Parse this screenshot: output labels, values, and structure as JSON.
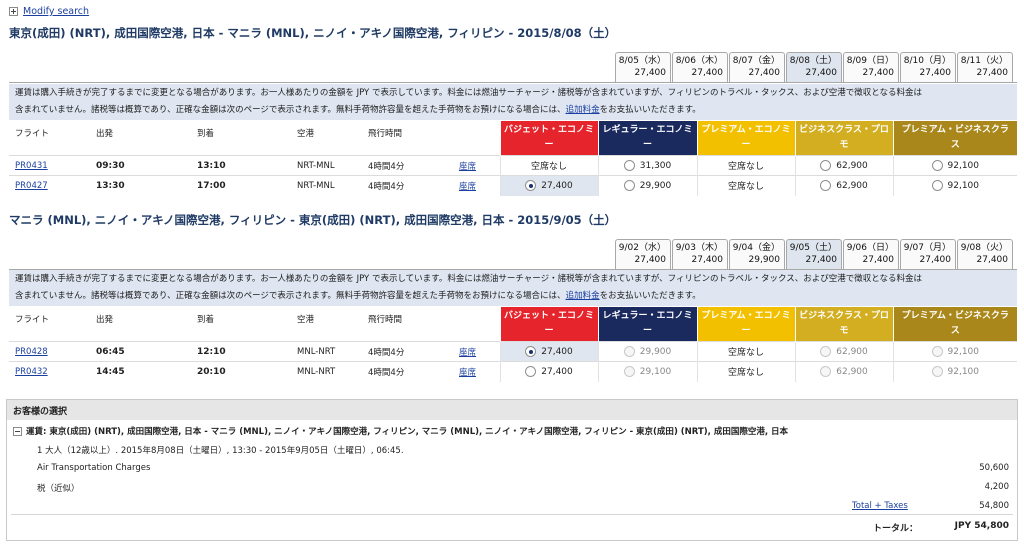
{
  "header": {
    "modify_search": "Modify search"
  },
  "outbound": {
    "title": "東京(成田) (NRT), 成田国際空港, 日本 - マニラ (MNL), ニノイ・アキノ国際空港, フィリピン - 2015/8/08（土）",
    "dates": [
      {
        "date": "8/05（水）",
        "price": "27,400"
      },
      {
        "date": "8/06（木）",
        "price": "27,400"
      },
      {
        "date": "8/07（金）",
        "price": "27,400"
      },
      {
        "date": "8/08（土）",
        "price": "27,400",
        "selected": true
      },
      {
        "date": "8/09（日）",
        "price": "27,400"
      },
      {
        "date": "8/10（月）",
        "price": "27,400"
      },
      {
        "date": "8/11（火）",
        "price": "27,400"
      }
    ],
    "notice_line1": "運賃は購入手続きが完了するまでに変更となる場合があります。お一人様あたりの金額を JPY で表示しています。料金には燃油サーチャージ・諸税等が含まれていますが、フィリピンのトラベル・タックス、および空港で徴収となる料金は",
    "notice_line2": "含まれていません。諸税等は概算であり、正確な金額は次のページで表示されます。無料手荷物許容量を超えた手荷物をお預けになる場合には、",
    "notice_link": "追加料金",
    "notice_tail": "をお支払いいただきます。",
    "flights": [
      {
        "flight": "PR0431",
        "depart": "09:30",
        "arrive": "13:10",
        "airport": "NRT-MNL",
        "duration": "4時間4分",
        "seat": "座席",
        "fares": [
          {
            "text": "空席なし",
            "kind": "none"
          },
          {
            "text": "31,300",
            "kind": "radio"
          },
          {
            "text": "空席なし",
            "kind": "none"
          },
          {
            "text": "62,900",
            "kind": "radio"
          },
          {
            "text": "92,100",
            "kind": "radio"
          }
        ]
      },
      {
        "flight": "PR0427",
        "depart": "13:30",
        "arrive": "17:00",
        "airport": "NRT-MNL",
        "duration": "4時間4分",
        "seat": "座席",
        "fares": [
          {
            "text": "27,400",
            "kind": "radio",
            "checked": true
          },
          {
            "text": "29,900",
            "kind": "radio"
          },
          {
            "text": "空席なし",
            "kind": "none"
          },
          {
            "text": "62,900",
            "kind": "radio"
          },
          {
            "text": "92,100",
            "kind": "radio"
          }
        ]
      }
    ]
  },
  "inbound": {
    "title": "マニラ (MNL), ニノイ・アキノ国際空港, フィリピン - 東京(成田) (NRT), 成田国際空港, 日本 - 2015/9/05（土）",
    "dates": [
      {
        "date": "9/02（水）",
        "price": "27,400"
      },
      {
        "date": "9/03（木）",
        "price": "27,400"
      },
      {
        "date": "9/04（金）",
        "price": "29,900"
      },
      {
        "date": "9/05（土）",
        "price": "27,400",
        "selected": true
      },
      {
        "date": "9/06（日）",
        "price": "27,400"
      },
      {
        "date": "9/07（月）",
        "price": "27,400"
      },
      {
        "date": "9/08（火）",
        "price": "27,400"
      }
    ],
    "notice_line1": "運賃は購入手続きが完了するまでに変更となる場合があります。お一人様あたりの金額を JPY で表示しています。料金には燃油サーチャージ・諸税等が含まれていますが、フィリピンのトラベル・タックス、および空港で徴収となる料金は",
    "notice_line2": "含まれていません。諸税等は概算であり、正確な金額は次のページで表示されます。無料手荷物許容量を超えた手荷物をお預けになる場合には、",
    "notice_link": "追加料金",
    "notice_tail": "をお支払いいただきます。",
    "flights": [
      {
        "flight": "PR0428",
        "depart": "06:45",
        "arrive": "12:10",
        "airport": "MNL-NRT",
        "duration": "4時間4分",
        "seat": "座席",
        "fares": [
          {
            "text": "27,400",
            "kind": "radio",
            "checked": true
          },
          {
            "text": "29,900",
            "kind": "disabled"
          },
          {
            "text": "空席なし",
            "kind": "none"
          },
          {
            "text": "62,900",
            "kind": "disabled"
          },
          {
            "text": "92,100",
            "kind": "disabled"
          }
        ]
      },
      {
        "flight": "PR0432",
        "depart": "14:45",
        "arrive": "20:10",
        "airport": "MNL-NRT",
        "duration": "4時間4分",
        "seat": "座席",
        "fares": [
          {
            "text": "27,400",
            "kind": "radio"
          },
          {
            "text": "29,100",
            "kind": "disabled"
          },
          {
            "text": "空席なし",
            "kind": "none"
          },
          {
            "text": "62,900",
            "kind": "disabled"
          },
          {
            "text": "92,100",
            "kind": "disabled"
          }
        ]
      }
    ]
  },
  "columns": {
    "flight": "フライト",
    "depart": "出発",
    "arrive": "到着",
    "airport": "空港",
    "duration": "飛行時間",
    "cabins": [
      {
        "line1": "バジェット・エコノミ",
        "line2": "ー",
        "color": "#e5242b"
      },
      {
        "line1": "レギュラー・エコノミ",
        "line2": "ー",
        "color": "#1b2a5e"
      },
      {
        "line1": "プレミアム・エコノミ",
        "line2": "ー",
        "color": "#f3c000"
      },
      {
        "line1": "ビジネスクラス・プロ",
        "line2": "モ",
        "color": "#d3ae20"
      },
      {
        "line1": "プレミアム・ビジネスクラ",
        "line2": "ス",
        "color": "#a9871a"
      }
    ]
  },
  "summary": {
    "heading": "お客様の選択",
    "fare_line": "運賃: 東京(成田) (NRT), 成田国際空港, 日本 - マニラ (MNL), ニノイ・アキノ国際空港, フィリピン, マニラ (MNL), ニノイ・アキノ国際空港, フィリピン - 東京(成田) (NRT), 成田国際空港, 日本",
    "pax_line": "1 大人（12歳以上）. 2015年8月08日（土曜日）, 13:30 - 2015年9月05日（土曜日）, 06:45.",
    "air_label": "Air Transportation Charges",
    "air_value": "50,600",
    "tax_label": "税（近似）",
    "tax_value": "4,200",
    "total_taxes_label": "Total + Taxes",
    "total_taxes_value": "54,800",
    "total_label": "トータル：",
    "total_value": "JPY 54,800"
  }
}
